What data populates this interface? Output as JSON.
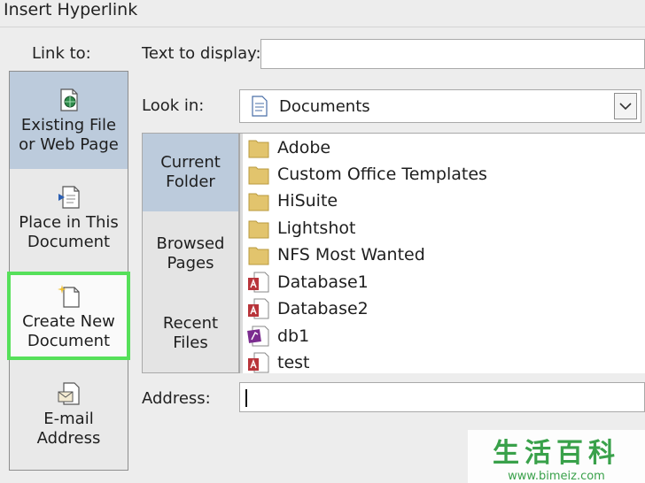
{
  "window": {
    "title": "Insert Hyperlink"
  },
  "link_to": {
    "label": "Link to:",
    "items": [
      {
        "label_line1": "Existing File",
        "label_line2": "or Web Page",
        "selected": true,
        "icon": "web-file-icon"
      },
      {
        "label_line1": "Place in This",
        "label_line2": "Document",
        "selected": false,
        "icon": "place-in-document-icon"
      },
      {
        "label_line1": "Create New",
        "label_line2": "Document",
        "selected": false,
        "highlighted": true,
        "icon": "new-document-icon"
      },
      {
        "label_line1": "E-mail",
        "label_line2": "Address",
        "selected": false,
        "icon": "email-icon"
      }
    ]
  },
  "text_to_display": {
    "label": "Text to display:",
    "value": ""
  },
  "look_in": {
    "label": "Look in:",
    "value": "Documents"
  },
  "places": [
    {
      "label_line1": "Current",
      "label_line2": "Folder",
      "selected": true
    },
    {
      "label_line1": "Browsed",
      "label_line2": "Pages",
      "selected": false
    },
    {
      "label_line1": "Recent",
      "label_line2": "Files",
      "selected": false
    }
  ],
  "files": [
    {
      "name": "Adobe",
      "type": "folder"
    },
    {
      "name": "Custom Office Templates",
      "type": "folder"
    },
    {
      "name": "HiSuite",
      "type": "folder"
    },
    {
      "name": "Lightshot",
      "type": "folder"
    },
    {
      "name": "NFS Most Wanted",
      "type": "folder"
    },
    {
      "name": "Database1",
      "type": "access"
    },
    {
      "name": "Database2",
      "type": "access"
    },
    {
      "name": "db1",
      "type": "pub"
    },
    {
      "name": "test",
      "type": "access"
    }
  ],
  "address": {
    "label": "Address:",
    "value": ""
  },
  "watermark": {
    "text_cn": "生活百科",
    "url": "www.bimeiz.com"
  },
  "colors": {
    "selected_bg": "#bccbdc",
    "highlight_border": "#56e05a",
    "folder": "#e2c46d",
    "access_red": "#b8343a"
  }
}
